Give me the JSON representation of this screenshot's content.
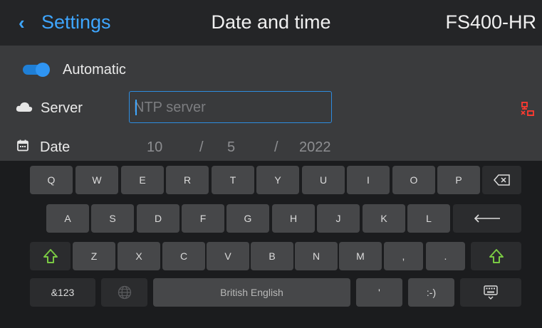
{
  "header": {
    "back_icon": "chevron-left-icon",
    "back_label": "Settings",
    "title": "Date and time",
    "device": "FS400-HR"
  },
  "settings": {
    "automatic": {
      "label": "Automatic",
      "checked": true
    },
    "server": {
      "label": "Server",
      "placeholder": "NTP server",
      "value": "",
      "status_icon": "network-disconnected-icon",
      "status_color": "#ff3b30"
    },
    "date": {
      "label": "Date",
      "day": "10",
      "sep1": "/",
      "month": "5",
      "sep2": "/",
      "year": "2022"
    }
  },
  "keyboard": {
    "row1": [
      "Q",
      "W",
      "E",
      "R",
      "T",
      "Y",
      "U",
      "I",
      "O",
      "P"
    ],
    "row2": [
      "A",
      "S",
      "D",
      "F",
      "G",
      "H",
      "J",
      "K",
      "L"
    ],
    "row3": [
      "Z",
      "X",
      "C",
      "V",
      "B",
      "N",
      "M",
      ",",
      "."
    ],
    "row4": {
      "symbols": "&123",
      "language": "British English",
      "apostrophe": "'",
      "smiley": ":-)"
    },
    "icons": {
      "backspace": "backspace-icon",
      "enter": "enter-icon",
      "shift": "shift-icon",
      "globe": "globe-icon",
      "hide": "keyboard-hide-icon"
    },
    "accent_color": "#7ac943"
  }
}
